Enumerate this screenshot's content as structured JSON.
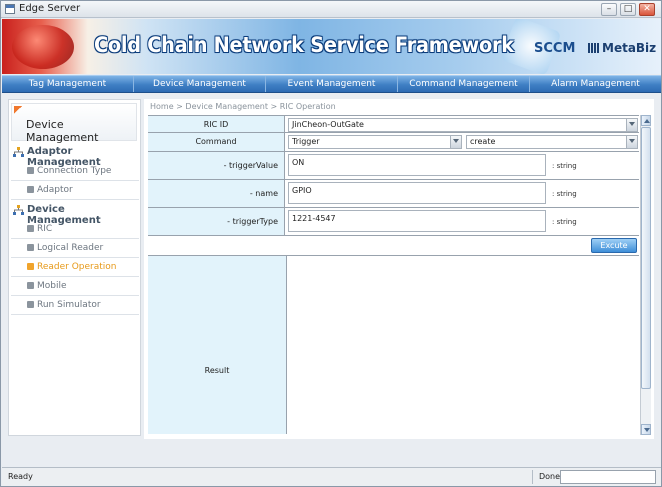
{
  "window": {
    "title": "Edge Server",
    "minimize": "–",
    "maximize": "□",
    "close": "✕"
  },
  "banner": {
    "title": "Cold Chain Network Service Framework",
    "logo_sccm": "SCCM",
    "logo_metabiz": "MetaBiz"
  },
  "menu": [
    "Tag Management",
    "Device Management",
    "Event Management",
    "Command Management",
    "Alarm Management"
  ],
  "sidebar": {
    "header": "Device Management",
    "sections": [
      {
        "label": "Adaptor Management",
        "items": [
          "Connection Type",
          "Adaptor"
        ]
      },
      {
        "label": "Device Management",
        "items": [
          "RIC",
          "Logical Reader",
          "Reader Operation",
          "Mobile",
          "Run Simulator"
        ]
      }
    ],
    "active_item": "Reader Operation"
  },
  "breadcrumb": "Home > Device Management > RIC Operation",
  "form": {
    "ric_id": {
      "label": "RIC ID",
      "value": "JinCheon-OutGate"
    },
    "command": {
      "label": "Command",
      "value": "Trigger",
      "action_value": "create"
    },
    "params": [
      {
        "label": "- triggerValue",
        "value": "ON",
        "type": ": string"
      },
      {
        "label": "- name",
        "value": "GPIO",
        "type": ": string"
      },
      {
        "label": "- triggerType",
        "value": "1221-4547",
        "type": ": string"
      }
    ],
    "execute_label": "Excute",
    "result_label": "Result"
  },
  "status": {
    "left": "Ready",
    "right": "Done"
  }
}
